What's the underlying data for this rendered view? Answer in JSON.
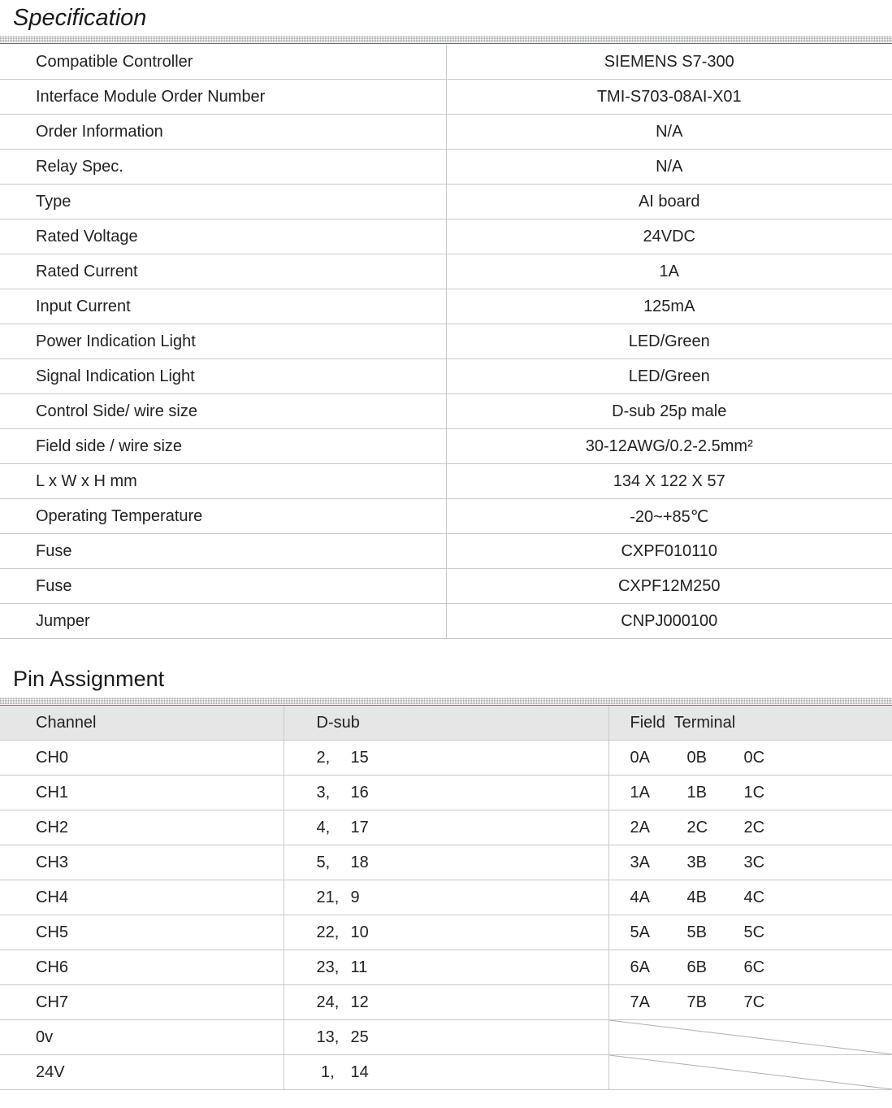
{
  "specification": {
    "title": "Specification",
    "rows": [
      {
        "label": "Compatible Controller",
        "value": "SIEMENS S7-300"
      },
      {
        "label": "Interface Module Order Number",
        "value": "TMI-S703-08AI-X01"
      },
      {
        "label": "Order Information",
        "value": "N/A"
      },
      {
        "label": "Relay Spec.",
        "value": "N/A"
      },
      {
        "label": "Type",
        "value": "AI board"
      },
      {
        "label": "Rated Voltage",
        "value": "24VDC"
      },
      {
        "label": "Rated Current",
        "value": "1A"
      },
      {
        "label": "Input Current",
        "value": "125mA"
      },
      {
        "label": "Power Indication Light",
        "value": "LED/Green"
      },
      {
        "label": "Signal Indication Light",
        "value": "LED/Green"
      },
      {
        "label": "Control Side/ wire size",
        "value": "D-sub 25p male"
      },
      {
        "label": "Field side / wire size",
        "value": "30-12AWG/0.2-2.5mm²"
      },
      {
        "label": "L x W x H mm",
        "value": "134 X 122 X 57"
      },
      {
        "label": "Operating Temperature",
        "value": "-20~+85℃"
      },
      {
        "label": "Fuse",
        "value": "CXPF010110"
      },
      {
        "label": "Fuse",
        "value": "CXPF12M250"
      },
      {
        "label": "Jumper",
        "value": "CNPJ000100"
      }
    ]
  },
  "pin_assignment": {
    "title": "Pin Assignment",
    "headers": {
      "channel": "Channel",
      "dsub": "D-sub",
      "field": "Field  Terminal"
    },
    "rows": [
      {
        "channel": "CH0",
        "dsub_a": "2,",
        "dsub_b": "15",
        "t1": "0A",
        "t2": "0B",
        "t3": "0C"
      },
      {
        "channel": "CH1",
        "dsub_a": "3,",
        "dsub_b": "16",
        "t1": "1A",
        "t2": "1B",
        "t3": "1C"
      },
      {
        "channel": "CH2",
        "dsub_a": "4,",
        "dsub_b": "17",
        "t1": "2A",
        "t2": "2C",
        "t3": "2C"
      },
      {
        "channel": "CH3",
        "dsub_a": "5,",
        "dsub_b": "18",
        "t1": "3A",
        "t2": "3B",
        "t3": "3C"
      },
      {
        "channel": "CH4",
        "dsub_a": "21,",
        "dsub_b": "9",
        "t1": "4A",
        "t2": "4B",
        "t3": "4C"
      },
      {
        "channel": "CH5",
        "dsub_a": "22,",
        "dsub_b": "10",
        "t1": "5A",
        "t2": "5B",
        "t3": "5C"
      },
      {
        "channel": "CH6",
        "dsub_a": "23,",
        "dsub_b": "11",
        "t1": "6A",
        "t2": "6B",
        "t3": "6C"
      },
      {
        "channel": "CH7",
        "dsub_a": "24,",
        "dsub_b": "12",
        "t1": "7A",
        "t2": "7B",
        "t3": "7C"
      },
      {
        "channel": "0v",
        "dsub_a": "13,",
        "dsub_b": "25"
      },
      {
        "channel": "24V",
        "dsub_a": " 1,",
        "dsub_b": "14"
      }
    ]
  }
}
